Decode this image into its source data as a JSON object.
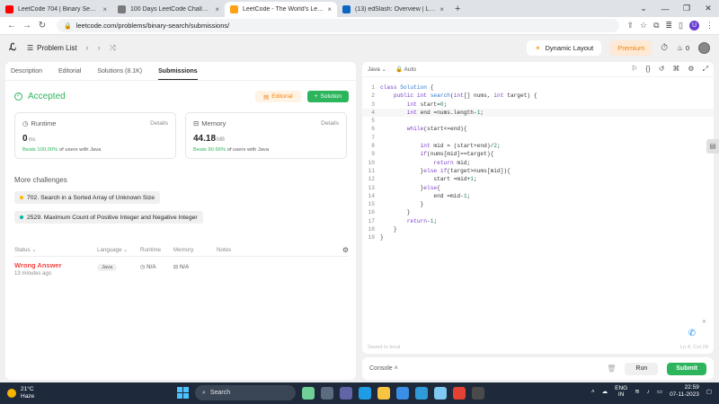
{
  "browser": {
    "tabs": [
      {
        "title": "LeetCode 704 | Binary Search | B",
        "color": "#ff0000"
      },
      {
        "title": "100 Days LeetCode Challenge",
        "color": "#555555"
      },
      {
        "title": "LeetCode - The World's Leading",
        "color": "#ffa116",
        "active": true
      },
      {
        "title": "(13) edSlash: Overview | LinkedIn",
        "color": "#0a66c2"
      }
    ],
    "url": "leetcode.com/problems/binary-search/submissions/",
    "profile_initial": "U"
  },
  "header": {
    "problem_list": "Problem List",
    "dynamic_layout": "Dynamic Layout",
    "premium": "Premium",
    "notif_count": "0"
  },
  "left": {
    "tabs": [
      "Description",
      "Editorial",
      "Solutions (8.1K)",
      "Submissions"
    ],
    "status": "Accepted",
    "editorial_btn": "Editorial",
    "solution_btn": "Solution",
    "runtime": {
      "label": "Runtime",
      "details": "Details",
      "value": "0",
      "unit": "ms",
      "beats_pct": "Beats 100.00%",
      "beats_rest": "of users with Java"
    },
    "memory": {
      "label": "Memory",
      "details": "Details",
      "value": "44.18",
      "unit": "MB",
      "beats_pct": "Beats 90.66%",
      "beats_rest": "of users with Java"
    },
    "more_challenges": "More challenges",
    "challenges": [
      {
        "title": "702. Search in a Sorted Array of Unknown Size",
        "color": "#ffb800"
      },
      {
        "title": "2529. Maximum Count of Positive Integer and Negative Integer",
        "color": "#00b8a3"
      }
    ],
    "table": {
      "headers": {
        "status": "Status",
        "language": "Language",
        "runtime": "Runtime",
        "memory": "Memory",
        "notes": "Notes"
      },
      "row": {
        "status": "Wrong Answer",
        "time": "13 minutes ago",
        "language": "Java",
        "runtime": "N/A",
        "memory": "N/A"
      }
    }
  },
  "editor": {
    "language": "Java",
    "mode": "Auto",
    "lines": [
      "class Solution {",
      "    public int search(int[] nums, int target) {",
      "        int start=0;",
      "        int end =nums.length-1;",
      "",
      "        while(start<=end){",
      "",
      "            int mid = (start+end)/2;",
      "            if(nums[mid]==target){",
      "                return mid;",
      "            }else if(target>nums[mid]){",
      "                start =mid+1;",
      "            }else{",
      "                end =mid-1;",
      "            }",
      "        }",
      "        return-1;",
      "    }",
      "}"
    ],
    "saved": "Saved to local",
    "cursor": "Ln 4, Col 29"
  },
  "console": {
    "label": "Console",
    "run": "Run",
    "submit": "Submit"
  },
  "taskbar": {
    "temp": "21°C",
    "weather": "Haze",
    "search": "Search",
    "lang1": "ENG",
    "lang2": "IN",
    "time": "22:59",
    "date": "07-11-2023"
  }
}
